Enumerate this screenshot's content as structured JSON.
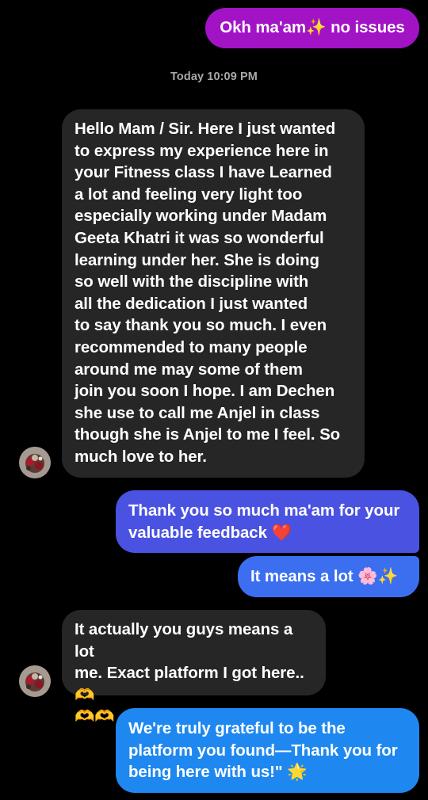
{
  "colors": {
    "background": "#000000",
    "incoming_bubble": "#262626",
    "outgoing_purple": "#a213c6",
    "outgoing_indigo": "#4a52e2",
    "outgoing_blue": "#3b6ff0",
    "outgoing_sky": "#1e88f0",
    "timestamp": "#a8a8a8"
  },
  "timestamp": "Today 10:09 PM",
  "messages": [
    {
      "direction": "outgoing",
      "text": "Okh ma'am✨ no issues"
    },
    {
      "direction": "incoming",
      "text": "Hello Mam / Sir. Here I just wanted\nto express my experience here in\nyour Fitness class I have Learned\na lot and feeling very light too\nespecially working under Madam\nGeeta Khatri it was so wonderful\nlearning under her. She is doing\nso well with the discipline with\nall the dedication I just wanted\nto say thank you so much. I even\nrecommended to many people\naround me may some of them\njoin you soon I hope. I am Dechen\nshe use to call me Anjel in class\nthough she is Anjel to me I feel. So\nmuch love to her."
    },
    {
      "direction": "outgoing",
      "text": "Thank you so much ma'am for your\nvaluable feedback ❤️"
    },
    {
      "direction": "outgoing",
      "text": "It means a lot 🌸✨"
    },
    {
      "direction": "incoming",
      "text": "It actually you guys means a lot\nme. Exact platform I got here..🫶\n🫶🫶"
    },
    {
      "direction": "outgoing",
      "text": "We're truly grateful to be the\nplatform you found—Thank you for\nbeing here with us!\" 🌟"
    }
  ]
}
